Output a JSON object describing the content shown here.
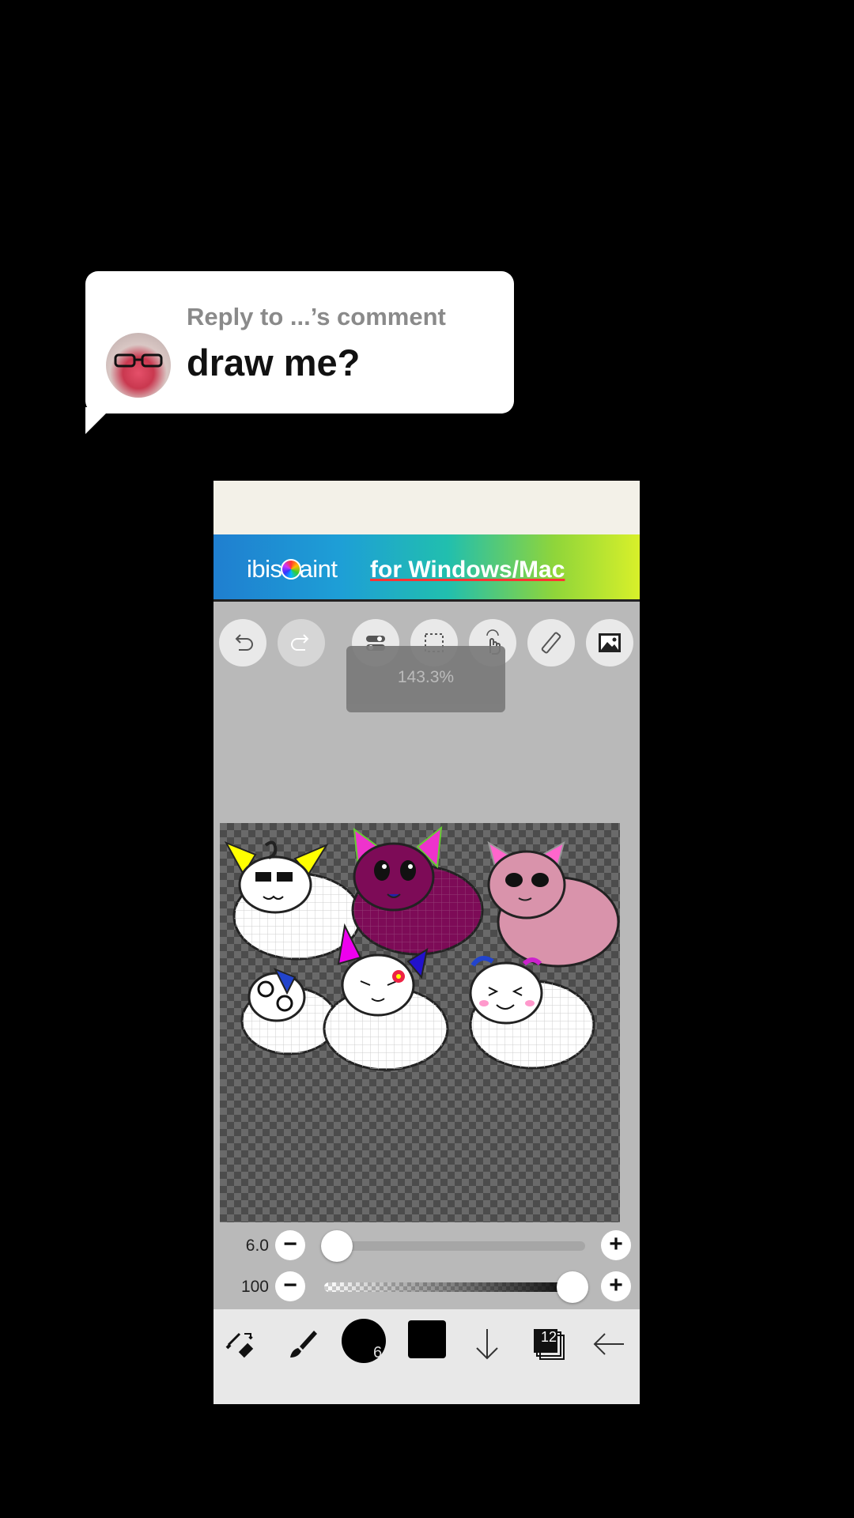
{
  "comment": {
    "reply_label": "Reply to ...’s comment",
    "text": "draw me?"
  },
  "app": {
    "banner_brand": "ibisPaint",
    "banner_brand_before": "ibis",
    "banner_brand_after": "aint",
    "banner_tagline": "for Windows/Mac",
    "toolbar": [
      {
        "name": "undo-icon",
        "state": "enabled"
      },
      {
        "name": "redo-icon",
        "state": "disabled"
      },
      {
        "name": "toggle-icon",
        "state": "enabled"
      },
      {
        "name": "selection-icon",
        "state": "enabled"
      },
      {
        "name": "hand-touch-icon",
        "state": "enabled"
      },
      {
        "name": "ruler-icon",
        "state": "enabled"
      },
      {
        "name": "image-icon",
        "state": "enabled"
      }
    ],
    "zoom": "143.3%",
    "brush_size_slider": {
      "value": "6.0",
      "level": 0.0
    },
    "opacity_slider": {
      "value": "100",
      "level": 1.0
    },
    "bottom_toolbar": {
      "brush_size_badge": "6",
      "layer_count": "12",
      "current_color": "#000000"
    }
  }
}
